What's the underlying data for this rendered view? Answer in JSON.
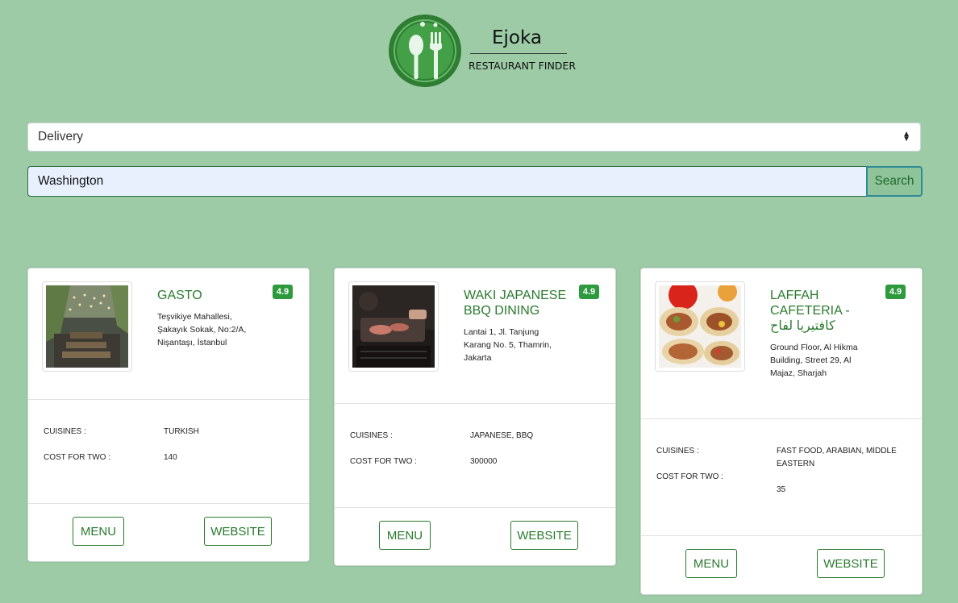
{
  "brand": {
    "name": "Ejoka",
    "subtitle": "RESTAURANT FINDER",
    "colors": {
      "dark": "#2e7d32",
      "mid": "#4caf50"
    }
  },
  "filter": {
    "selected": "Delivery"
  },
  "search": {
    "value": "Washington",
    "button_label": "Search"
  },
  "labels": {
    "cuisines": "CUISINES :",
    "cost": "COST FOR TWO :",
    "menu": "MENU",
    "website": "WEBSITE"
  },
  "restaurants": [
    {
      "name": "GASTO",
      "rating": "4.9",
      "address": "Teşvikiye Mahallesi, Şakayık Sokak, No:2/A, Nişantaşı, İstanbul",
      "cuisines": "TURKISH",
      "cost_for_two": "140",
      "image_icon": "restaurant-interior-photo"
    },
    {
      "name": "WAKI JAPANESE BBQ DINING",
      "rating": "4.9",
      "address": "Lantai 1, Jl. Tanjung Karang No. 5, Thamrin, Jakarta",
      "cuisines": "JAPANESE, BBQ",
      "cost_for_two": "300000",
      "image_icon": "bbq-food-photo"
    },
    {
      "name": "LAFFAH CAFETERIA - كافتيريا لفاح",
      "rating": "4.9",
      "address": "Ground Floor, Al Hikma Building, Street 29, Al Majaz, Sharjah",
      "cuisines": "FAST FOOD, ARABIAN, MIDDLE EASTERN",
      "cost_for_two": "35",
      "image_icon": "wrap-food-photo"
    }
  ]
}
